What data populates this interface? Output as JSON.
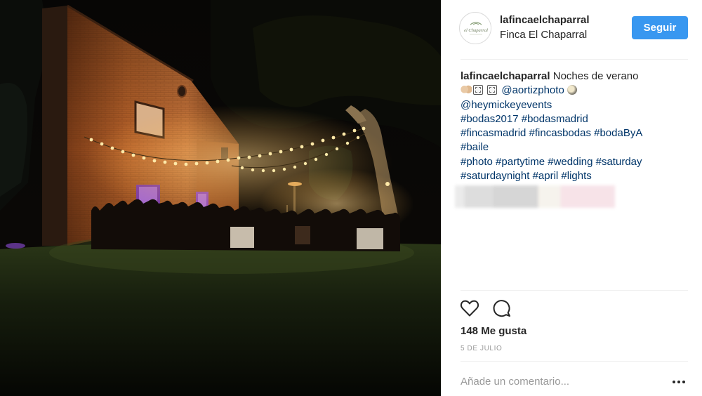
{
  "post": {
    "image_alt": "Noches de verano",
    "header": {
      "username": "lafincaelchaparral",
      "location": "Finca El Chaparral",
      "avatar_text": "el Chaparral",
      "follow_label": "Seguir"
    },
    "caption": {
      "username": "lafincaelchaparral",
      "text": "Noches de verano",
      "mention_1": "@aortizphoto",
      "mention_2": "@heymickeyevents",
      "tags_line_1": "#bodas2017 #bodasmadrid",
      "tags_line_2": "#fincasmadrid #fincasbodas #bodaByA",
      "tags_line_3": "#baile",
      "tags_line_4": "#photo #partytime #wedding #saturday",
      "tags_line_5": "#saturdaynight #april #lights"
    },
    "likes": "148 Me gusta",
    "date": "5 DE JULIO",
    "comment_placeholder": "Añade un comentario...",
    "icons": {
      "like": "heart-icon",
      "comment": "comment-bubble-icon",
      "more": "more-options-icon"
    },
    "colors": {
      "follow_button": "#3897f0",
      "link": "#003569",
      "text": "#262626",
      "muted": "#999999"
    }
  }
}
